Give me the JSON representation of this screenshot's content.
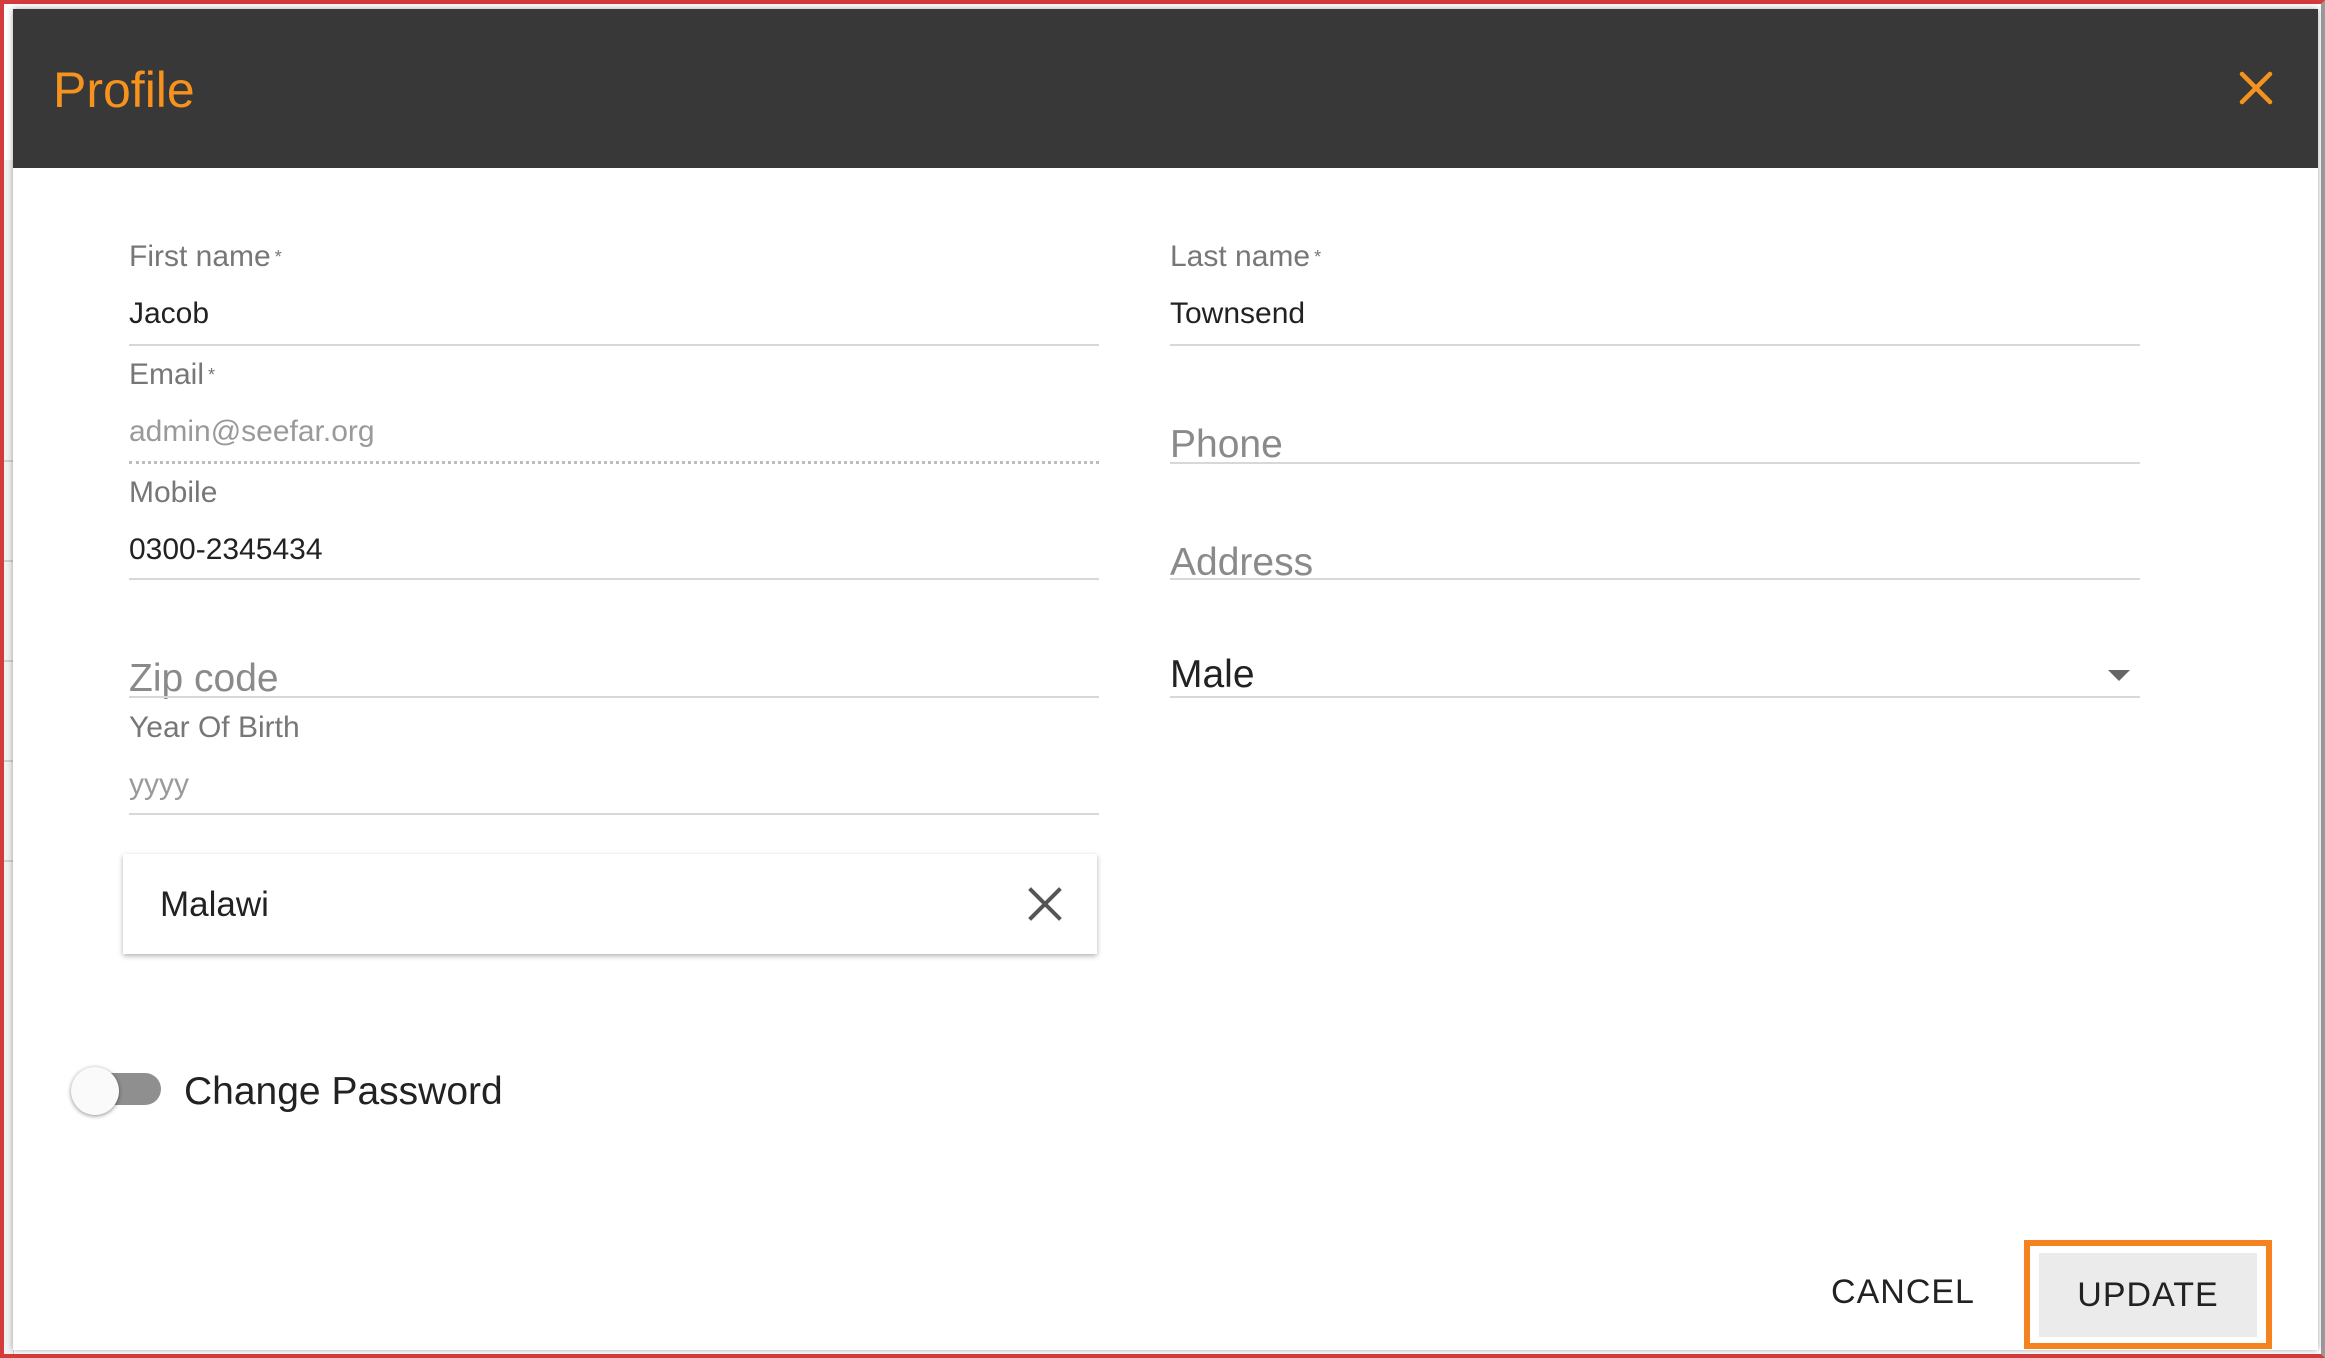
{
  "dialog": {
    "title": "Profile",
    "accent_color": "#f6921e",
    "header_color": "#383838",
    "close_icon": "close-icon"
  },
  "form": {
    "first_name": {
      "label": "First name",
      "required_mark": "*",
      "value": "Jacob"
    },
    "last_name": {
      "label": "Last name",
      "required_mark": "*",
      "value": "Townsend"
    },
    "email": {
      "label": "Email",
      "required_mark": "*",
      "value": "admin@seefar.org"
    },
    "phone": {
      "placeholder": "Phone"
    },
    "mobile": {
      "label": "Mobile",
      "value": "0300-2345434"
    },
    "address": {
      "placeholder": "Address"
    },
    "zip_code": {
      "placeholder": "Zip code"
    },
    "gender": {
      "selected": "Male"
    },
    "year_of_birth": {
      "label": "Year Of Birth",
      "placeholder": "yyyy"
    },
    "country": {
      "value": "Malawi",
      "clear_icon": "close-icon"
    },
    "change_password": {
      "label": "Change Password",
      "enabled": false
    }
  },
  "actions": {
    "cancel_label": "CANCEL",
    "update_label": "UPDATE",
    "highlight_color": "#f6821f"
  }
}
